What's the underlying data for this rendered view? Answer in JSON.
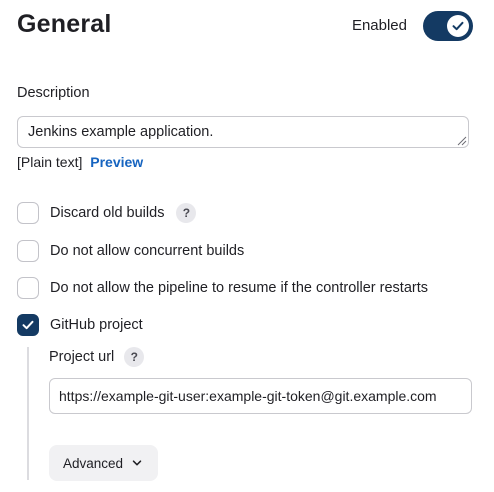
{
  "header": {
    "title": "General",
    "enabled_label": "Enabled",
    "enabled": true
  },
  "description": {
    "label": "Description",
    "value": "Jenkins example application.",
    "format_text": "[Plain text]",
    "preview_link": "Preview"
  },
  "options": [
    {
      "label": "Discard old builds",
      "checked": false,
      "has_help": true
    },
    {
      "label": "Do not allow concurrent builds",
      "checked": false,
      "has_help": false
    },
    {
      "label": "Do not allow the pipeline to resume if the controller restarts",
      "checked": false,
      "has_help": false
    },
    {
      "label": "GitHub project",
      "checked": true,
      "has_help": false
    }
  ],
  "github_project": {
    "url_label": "Project url",
    "url_value": "https://example-git-user:example-git-token@git.example.com",
    "advanced_label": "Advanced"
  },
  "icons": {
    "help": "?"
  },
  "colors": {
    "accent": "#143a63",
    "link": "#1664c0"
  }
}
